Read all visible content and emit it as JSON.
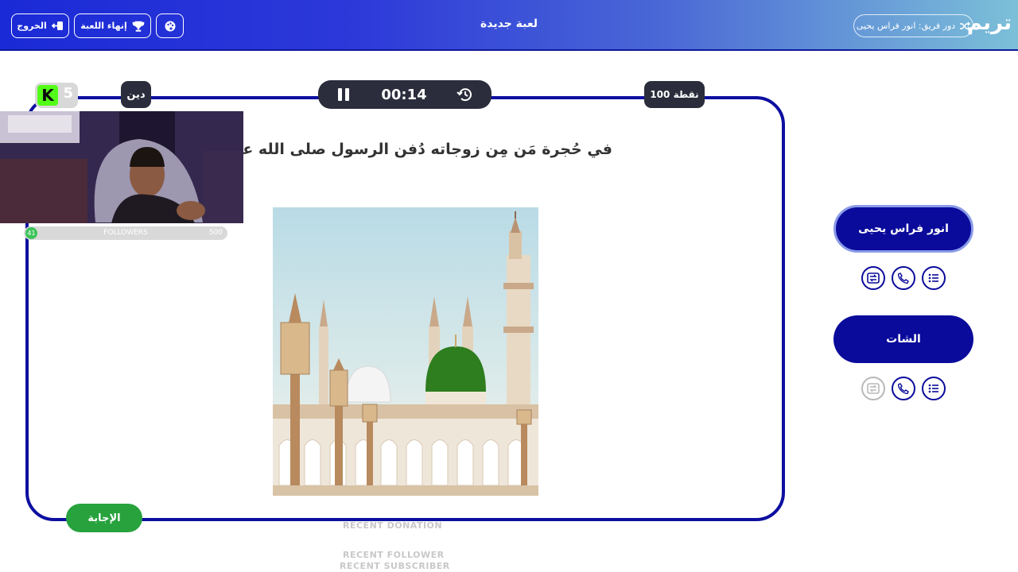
{
  "header": {
    "logo": "تريم",
    "turn_label": "دور فريق: انور فراس يحيى",
    "title": "لعبة جديدة",
    "end_game": "إنهاء اللعبة",
    "exit": "الخروج"
  },
  "game": {
    "timer": "00:14",
    "category": "دين",
    "points": "100 نقطة",
    "question": "في حُجرة مَن مِن زوجاته دُفن الرسول صلى الله عليه وسلم؟",
    "answer_button": "الإجابة"
  },
  "stream": {
    "kick_count": "5",
    "followers_label": "FOLLOWERS",
    "followers_current": "41",
    "followers_goal": "500",
    "followers_progress": 0.082,
    "recent_donation": "RECENT DONATION",
    "recent_follower": "RECENT FOLLOWER",
    "recent_subscriber": "RECENT SUBSCRIBER"
  },
  "teams": [
    {
      "name": "انور فراس يحيى",
      "active": true
    },
    {
      "name": "الشات",
      "active": false
    }
  ],
  "colors": {
    "primary": "#0a0b9b",
    "answer": "#27a23d",
    "kick_green": "#53fc18",
    "dome_green": "#2e7d1f"
  }
}
